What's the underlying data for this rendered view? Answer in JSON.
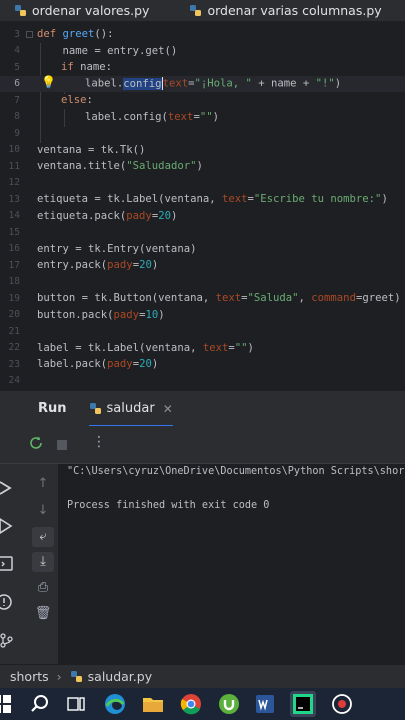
{
  "tabs": [
    {
      "label": "ordenar valores.py"
    },
    {
      "label": "ordenar varias columnas.py"
    }
  ],
  "editor": {
    "line_numbers": [
      "3",
      "4",
      "5",
      "6",
      "7",
      "8",
      "9",
      "10",
      "11",
      "12",
      "13",
      "14",
      "15",
      "16",
      "17",
      "18",
      "19",
      "20",
      "21",
      "22",
      "23",
      "24"
    ],
    "lines": {
      "l3": {
        "def": "def ",
        "name": "greet",
        "rest": "():"
      },
      "l4": {
        "text": "    name = entry.get()"
      },
      "l5": {
        "kw": "if ",
        "rest": "name:"
      },
      "l6": {
        "a": "label.",
        "sel": "config",
        "kwarg": "text",
        "eq": "=",
        "s1": "\"¡Hola, \"",
        "mid": " + name + ",
        "s2": "\"!\"",
        "end": ")"
      },
      "l7": {
        "kw": "else",
        "rest": ":"
      },
      "l8": {
        "a": "label.config(",
        "kwarg": "text",
        "eq": "=",
        "s": "\"\"",
        "end": ")"
      },
      "l10": {
        "text": "ventana = tk.Tk()"
      },
      "l11": {
        "a": "ventana.title(",
        "s": "\"Saludador\"",
        "end": ")"
      },
      "l13": {
        "a": "etiqueta = tk.Label(ventana, ",
        "kwarg": "text",
        "eq": "=",
        "s": "\"Escribe tu nombre:\"",
        "end": ")"
      },
      "l14": {
        "a": "etiqueta.pack(",
        "kwarg": "pady",
        "eq": "=",
        "n": "20",
        "end": ")"
      },
      "l16": {
        "text": "entry = tk.Entry(ventana)"
      },
      "l17": {
        "a": "entry.pack(",
        "kwarg": "pady",
        "eq": "=",
        "n": "20",
        "end": ")"
      },
      "l19": {
        "a": "button = tk.Button(ventana, ",
        "kwarg": "text",
        "eq": "=",
        "s": "\"Saluda\"",
        "mid": ", ",
        "kwarg2": "command",
        "eq2": "=",
        "end": "greet)"
      },
      "l20": {
        "a": "button.pack(",
        "kwarg": "pady",
        "eq": "=",
        "n": "10",
        "end": ")"
      },
      "l22": {
        "a": "label = tk.Label(ventana, ",
        "kwarg": "text",
        "eq": "=",
        "s": "\"\"",
        "end": ")"
      },
      "l23": {
        "a": "label.pack(",
        "kwarg": "pady",
        "eq": "=",
        "n": "20",
        "end": ")"
      }
    }
  },
  "run_panel": {
    "title": "Run",
    "tab_label": "saludar",
    "console_lines": [
      "\"C:\\Users\\cyruz\\OneDrive\\Documentos\\Python Scripts\\shor",
      "Process finished with exit code 0"
    ]
  },
  "breadcrumb": {
    "folder": "shorts",
    "file": "saludar.py"
  },
  "colors": {
    "accent": "#3574f0",
    "keyword": "#cf8e6d",
    "function": "#56a8f5",
    "string": "#6aab73",
    "number": "#2aacb8",
    "param": "#aa4926"
  },
  "icons": {
    "python_file": "python-icon",
    "rerun": "rerun-icon",
    "stop": "stop-icon",
    "more": "more-icon"
  }
}
